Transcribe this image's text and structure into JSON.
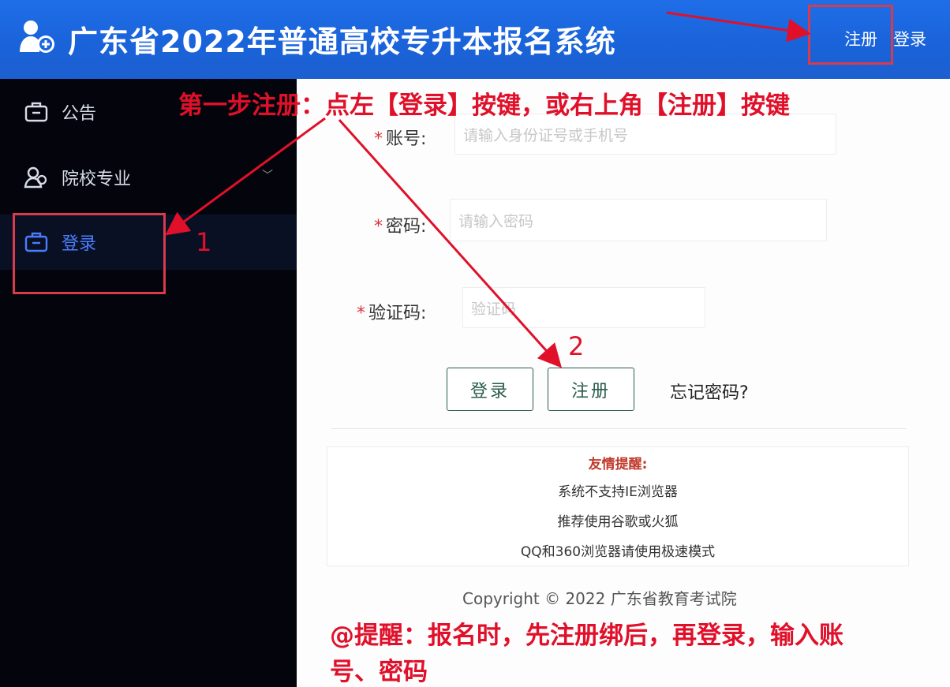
{
  "header": {
    "title": "广东省2022年普通高校专升本报名系统",
    "register_link": "注册",
    "login_link": "登录",
    "logo_icon": "user-add-icon"
  },
  "sidebar": {
    "items": [
      {
        "label": "公告",
        "icon": "briefcase-icon"
      },
      {
        "label": "院校专业",
        "icon": "people-icon",
        "has_chevron": true
      },
      {
        "label": "登录",
        "icon": "briefcase-icon",
        "active": true
      }
    ]
  },
  "form": {
    "account_label": "账号:",
    "account_placeholder": "请输入身份证号或手机号",
    "password_label": "密码:",
    "password_placeholder": "请输入密码",
    "captcha_label": "验证码:",
    "captcha_placeholder": "验证码",
    "login_button": "登录",
    "register_button": "注册",
    "forgot_link": "忘记密码?"
  },
  "notice": {
    "title": "友情提醒:",
    "lines": [
      "系统不支持IE浏览器",
      "推荐使用谷歌或火狐",
      "QQ和360浏览器请使用极速模式"
    ]
  },
  "footer": {
    "copyright": "Copyright © 2022 广东省教育考试院"
  },
  "annotations": {
    "step_one": "第一步注册：点左【登录】按键，或右上角【注册】按键",
    "marker_1": "1",
    "marker_2": "2",
    "reminder_line1": "@提醒：报名时，先注册绑后，再登录，输入账",
    "reminder_line2": "号、密码"
  },
  "colors": {
    "header_blue": "#1a66e0",
    "annotation_red": "#e0102a",
    "active_nav": "#4a7dff",
    "button_green": "#2a5c4d"
  }
}
